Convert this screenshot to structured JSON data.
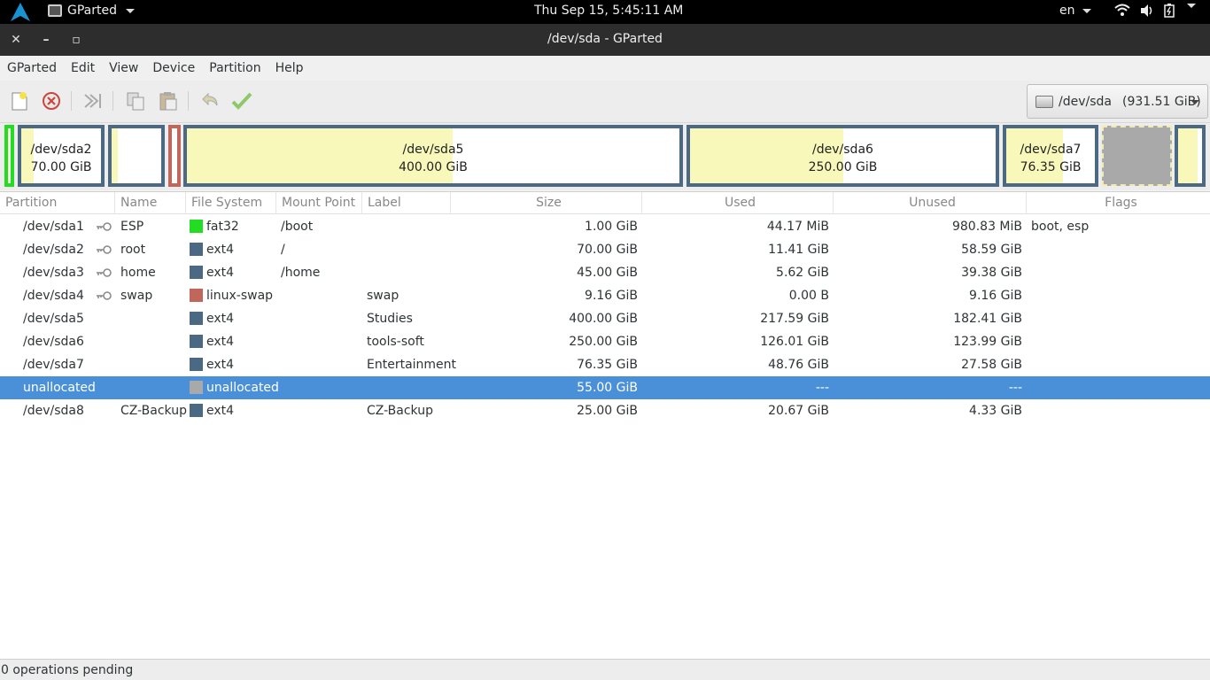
{
  "topbar": {
    "app_name": "GParted",
    "clock": "Thu Sep 15,  5:45:11 AM",
    "lang": "en",
    "tray_icons": [
      "wifi-icon",
      "volume-icon",
      "battery-icon"
    ]
  },
  "window": {
    "title": "/dev/sda - GParted",
    "close": "✕",
    "minimize": "–",
    "maximize": "▫"
  },
  "menu": [
    "GParted",
    "Edit",
    "View",
    "Device",
    "Partition",
    "Help"
  ],
  "toolbar": {
    "icons": [
      "new-icon",
      "delete-icon",
      "resize-icon",
      "copy-icon",
      "paste-icon",
      "undo-icon",
      "apply-icon"
    ]
  },
  "device": {
    "name": "/dev/sda",
    "size": "(931.51 GiB)"
  },
  "graph": {
    "sda2": {
      "name": "/dev/sda2",
      "size": "70.00 GiB"
    },
    "sda5": {
      "name": "/dev/sda5",
      "size": "400.00 GiB"
    },
    "sda6": {
      "name": "/dev/sda6",
      "size": "250.00 GiB"
    },
    "sda7": {
      "name": "/dev/sda7",
      "size": "76.35 GiB"
    }
  },
  "colors": {
    "fat32": "#22dd22",
    "ext4": "#4b6983",
    "linux-swap": "#c1665a",
    "unallocated": "#a9a9a9",
    "selection": "#4a90d9",
    "used": "#f8f8ba"
  },
  "columns": {
    "partition": "Partition",
    "name": "Name",
    "filesystem": "File System",
    "mount": "Mount Point",
    "label": "Label",
    "size": "Size",
    "used": "Used",
    "unused": "Unused",
    "flags": "Flags"
  },
  "rows": [
    {
      "partition": "/dev/sda1",
      "name": "ESP",
      "filesystem": "fat32",
      "mount": "/boot",
      "label": "",
      "size": "1.00 GiB",
      "used": "44.17 MiB",
      "unused": "980.83 MiB",
      "flags": "boot, esp"
    },
    {
      "partition": "/dev/sda2",
      "name": "root",
      "filesystem": "ext4",
      "mount": "/",
      "label": "",
      "size": "70.00 GiB",
      "used": "11.41 GiB",
      "unused": "58.59 GiB",
      "flags": ""
    },
    {
      "partition": "/dev/sda3",
      "name": "home",
      "filesystem": "ext4",
      "mount": "/home",
      "label": "",
      "size": "45.00 GiB",
      "used": "5.62 GiB",
      "unused": "39.38 GiB",
      "flags": ""
    },
    {
      "partition": "/dev/sda4",
      "name": "swap",
      "filesystem": "linux-swap",
      "mount": "",
      "label": "swap",
      "size": "9.16 GiB",
      "used": "0.00 B",
      "unused": "9.16 GiB",
      "flags": ""
    },
    {
      "partition": "/dev/sda5",
      "name": "",
      "filesystem": "ext4",
      "mount": "",
      "label": "Studies",
      "size": "400.00 GiB",
      "used": "217.59 GiB",
      "unused": "182.41 GiB",
      "flags": ""
    },
    {
      "partition": "/dev/sda6",
      "name": "",
      "filesystem": "ext4",
      "mount": "",
      "label": "tools-soft",
      "size": "250.00 GiB",
      "used": "126.01 GiB",
      "unused": "123.99 GiB",
      "flags": ""
    },
    {
      "partition": "/dev/sda7",
      "name": "",
      "filesystem": "ext4",
      "mount": "",
      "label": "Entertainment",
      "size": "76.35 GiB",
      "used": "48.76 GiB",
      "unused": "27.58 GiB",
      "flags": ""
    },
    {
      "partition": "unallocated",
      "name": "",
      "filesystem": "unallocated",
      "mount": "",
      "label": "",
      "size": "55.00 GiB",
      "used": "---",
      "unused": "---",
      "flags": ""
    },
    {
      "partition": "/dev/sda8",
      "name": "CZ-Backup",
      "filesystem": "ext4",
      "mount": "",
      "label": "CZ-Backup",
      "size": "25.00 GiB",
      "used": "20.67 GiB",
      "unused": "4.33 GiB",
      "flags": ""
    }
  ],
  "status": "0 operations pending"
}
